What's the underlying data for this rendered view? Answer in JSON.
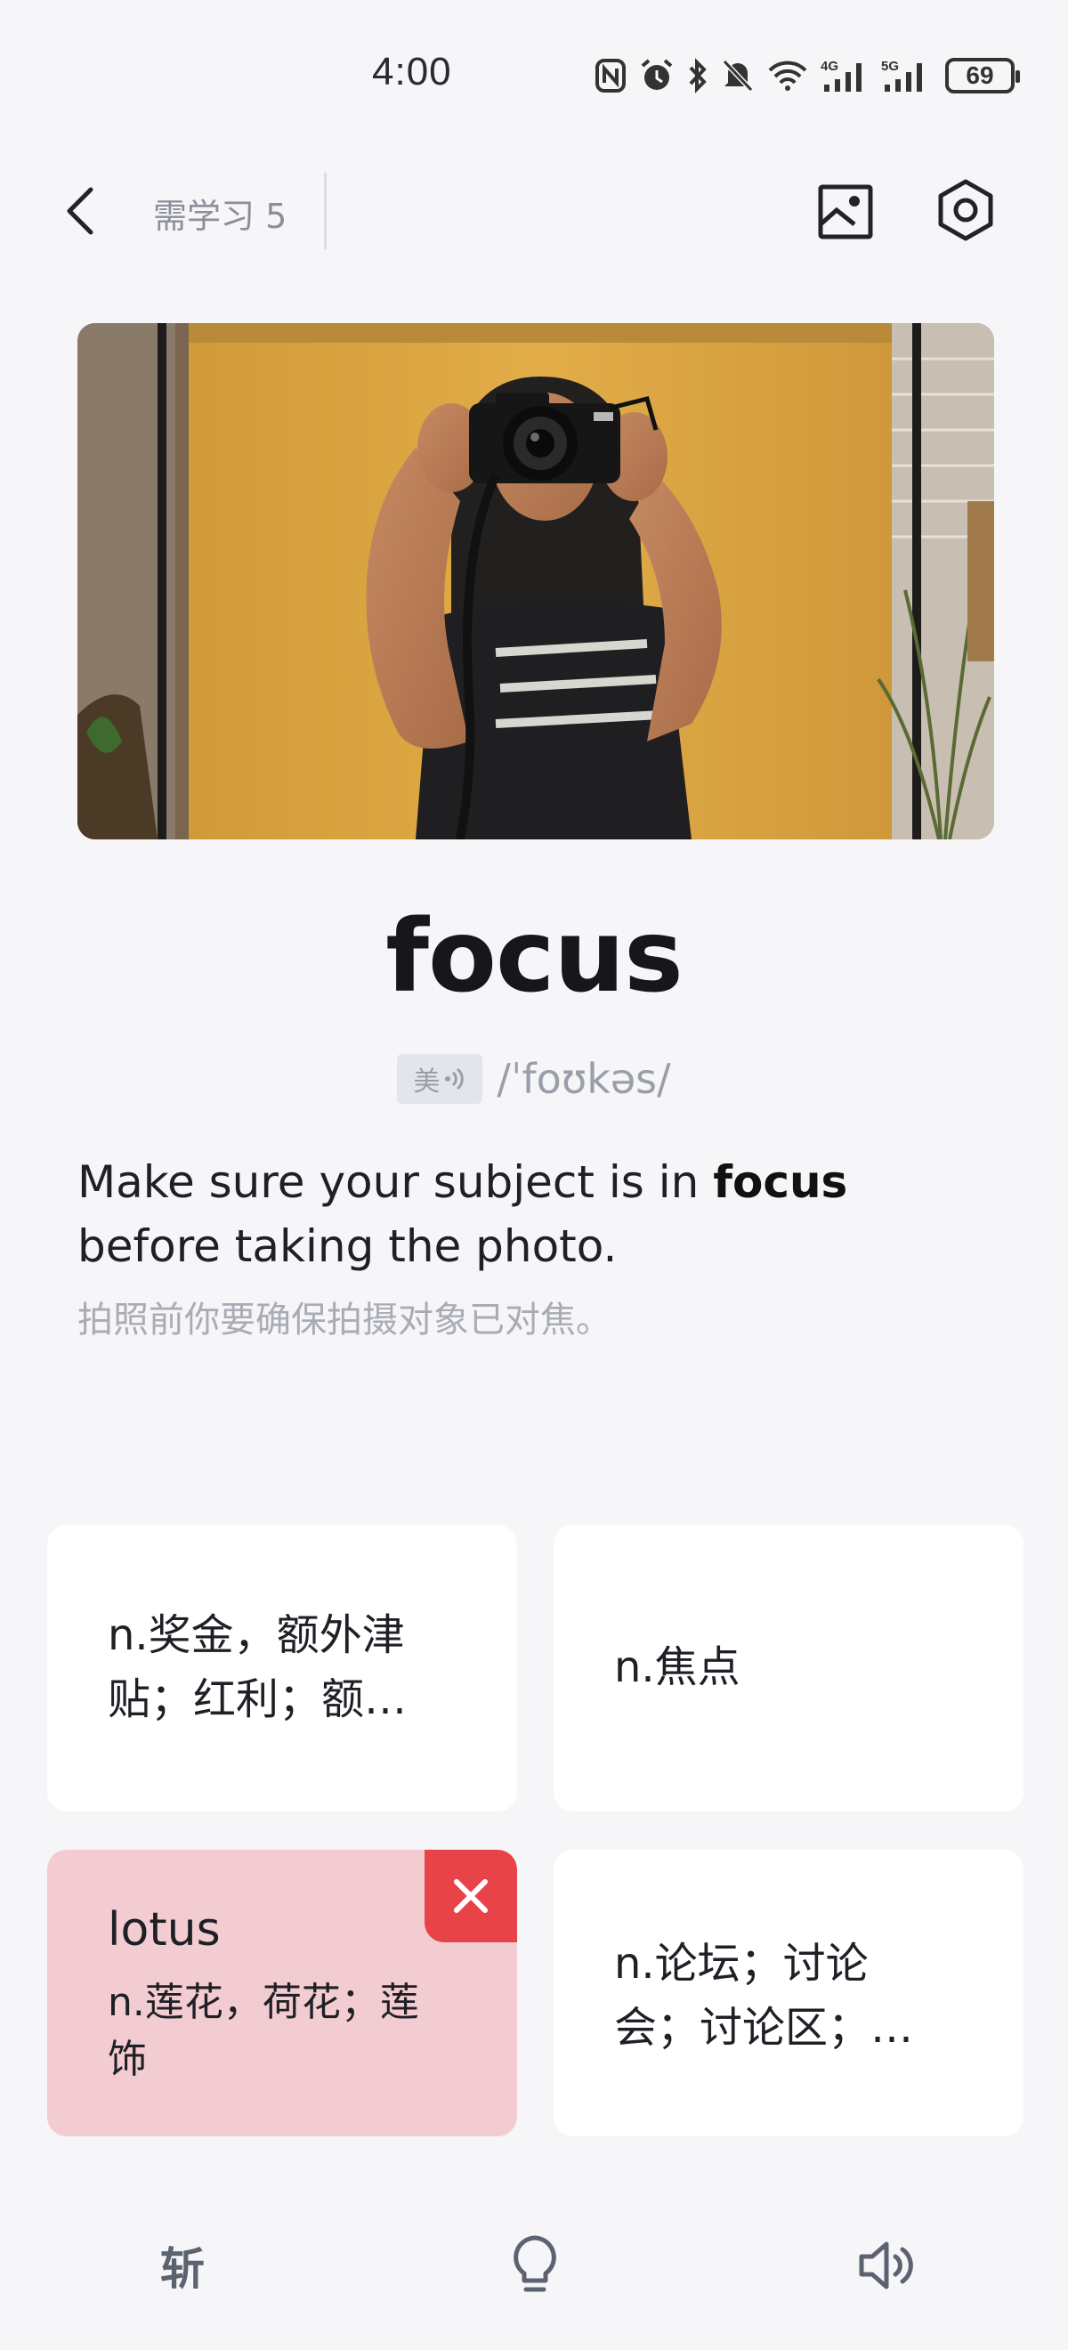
{
  "status_bar": {
    "time": "4:00",
    "battery": "69",
    "icons": [
      "nfc-icon",
      "alarm-icon",
      "bluetooth-icon",
      "mute-icon",
      "wifi-icon",
      "signal-4g-icon",
      "signal-5g-icon",
      "battery-icon"
    ]
  },
  "top_bar": {
    "learn_count": "需学习 5",
    "icons": [
      "back-icon",
      "image-icon",
      "settings-icon"
    ]
  },
  "word_card": {
    "word": "focus",
    "accent": "美",
    "phonetic": "/ˈfoʊkəs/",
    "example_before": "Make sure your subject is in ",
    "example_highlight": "focus",
    "example_after": " before taking the photo.",
    "example_translation": "拍照前你要确保拍摄对象已对焦。"
  },
  "options": [
    {
      "text": "n.奖金，额外津贴；红利；额…"
    },
    {
      "text": "n.焦点"
    },
    {
      "word": "lotus",
      "text": "n.莲花，荷花；莲饰",
      "state": "wrong"
    },
    {
      "text": "n.论坛；讨论会；讨论区；…"
    }
  ],
  "bottom_bar": {
    "cut_label": "斩",
    "icons": [
      "hint-bulb-icon",
      "speaker-icon"
    ]
  },
  "colors": {
    "background": "#f6f6f8",
    "wrong_card": "#f2ccd0",
    "wrong_badge": "#e9434a",
    "muted_text": "#8b8f9a"
  }
}
